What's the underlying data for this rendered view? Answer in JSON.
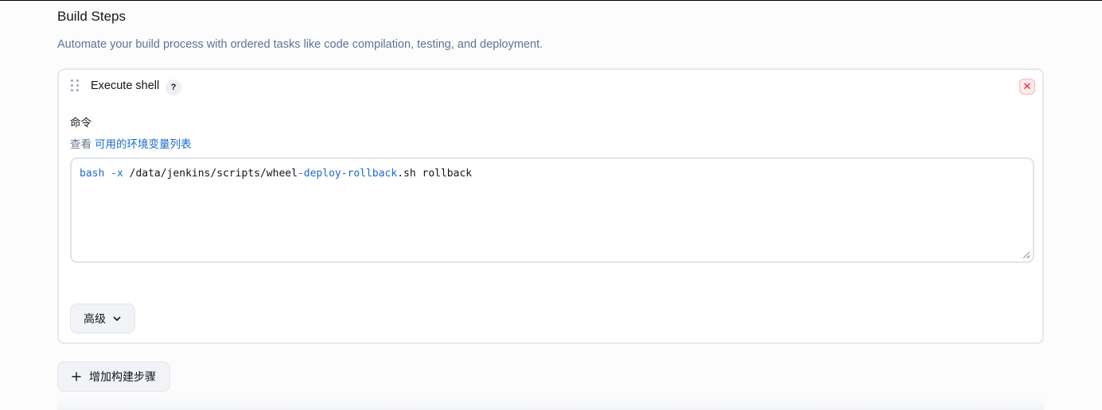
{
  "section": {
    "title": "Build Steps",
    "description": "Automate your build process with ordered tasks like code compilation, testing, and deployment."
  },
  "step": {
    "title": "Execute shell",
    "help_glyph": "?",
    "close_glyph": "✕",
    "command_label": "命令",
    "hint_prefix": "查看",
    "hint_link": "可用的环境变量列表",
    "command": {
      "t1": "bash",
      "t2": " ",
      "t3": "-x",
      "t4": " /data/jenkins/scripts/wheel",
      "t5": "-deploy-rollback",
      "t6": ".sh rollback"
    },
    "advanced_label": "高级"
  },
  "add_step": {
    "label": "增加构建步骤",
    "icon": "plus-icon"
  },
  "colors": {
    "accent_link": "#1a6bcc",
    "description_text": "#5e7394",
    "danger": "#e0242f"
  }
}
